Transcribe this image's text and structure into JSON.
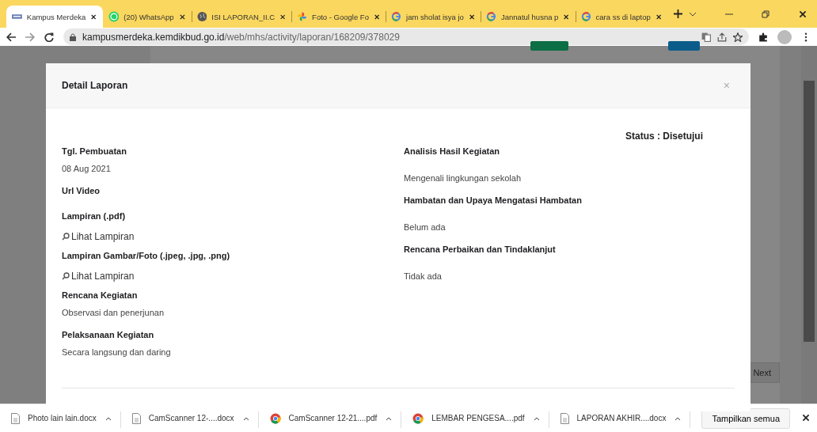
{
  "tabs": [
    {
      "title": "Kampus Merdeka",
      "kind": "site",
      "selected": true
    },
    {
      "title": "(20) WhatsApp",
      "kind": "whatsapp",
      "selected": false
    },
    {
      "title": "ISI LAPORAN_II.C",
      "kind": "globe",
      "selected": false
    },
    {
      "title": "Foto - Google Fo",
      "kind": "photos",
      "selected": false
    },
    {
      "title": "jam sholat isya jo",
      "kind": "google",
      "selected": false
    },
    {
      "title": "Jannatul husna p",
      "kind": "google",
      "selected": false
    },
    {
      "title": "cara ss di laptop",
      "kind": "google",
      "selected": false
    }
  ],
  "address_bar": {
    "domain": "kampusmerdeka.kemdikbud.go.id",
    "path": "/web/mhs/activity/laporan/168209/378029"
  },
  "background_page": {
    "next_button": "Next"
  },
  "modal": {
    "title": "Detail Laporan",
    "close": "×",
    "status": "Status : Disetujui",
    "left": [
      {
        "kind": "label",
        "text": "Tgl. Pembuatan"
      },
      {
        "kind": "value",
        "text": "08 Aug 2021"
      },
      {
        "kind": "label",
        "text": "Url Video"
      },
      {
        "kind": "label",
        "text": "Lampiran (.pdf)"
      },
      {
        "kind": "link",
        "text": "Lihat Lampiran"
      },
      {
        "kind": "label",
        "text": "Lampiran Gambar/Foto (.jpeg, .jpg, .png)"
      },
      {
        "kind": "link",
        "text": "Lihat Lampiran"
      },
      {
        "kind": "label",
        "text": "Rencana Kegiatan"
      },
      {
        "kind": "value",
        "text": "Observasi dan penerjunan"
      },
      {
        "kind": "label",
        "text": "Pelaksanaan Kegiatan"
      },
      {
        "kind": "value",
        "text": "Secara langsung dan daring"
      }
    ],
    "right": [
      {
        "kind": "label",
        "text": "Analisis Hasil Kegiatan"
      },
      {
        "kind": "value",
        "text": "Mengenali lingkungan sekolah"
      },
      {
        "kind": "label",
        "text": "Hambatan dan Upaya Mengatasi Hambatan"
      },
      {
        "kind": "value",
        "text": "Belum ada"
      },
      {
        "kind": "label",
        "text": "Rencana Perbaikan dan Tindaklanjut"
      },
      {
        "kind": "value",
        "text": "Tidak ada"
      }
    ]
  },
  "downloads": [
    {
      "name": "Photo lain lain.docx",
      "kind": "doc"
    },
    {
      "name": "CamScanner 12-....docx",
      "kind": "doc"
    },
    {
      "name": "CamScanner 12-21....pdf",
      "kind": "pdf"
    },
    {
      "name": "LEMBAR PENGESA....pdf",
      "kind": "pdf"
    },
    {
      "name": "LAPORAN AKHIR....docx",
      "kind": "doc"
    }
  ],
  "show_all_button": "Tampilkan semua"
}
